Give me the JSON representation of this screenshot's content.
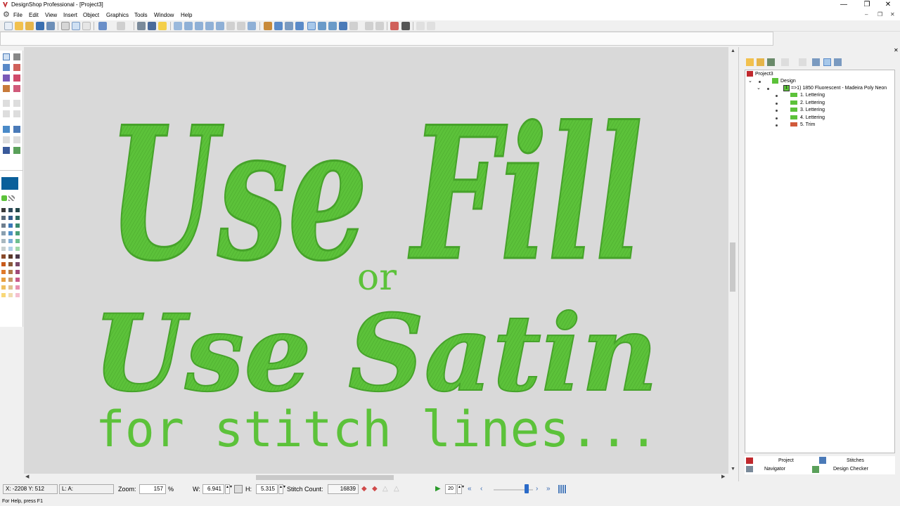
{
  "window": {
    "title": "DesignShop Professional - [Project3]",
    "minimize": "—",
    "restore": "❐",
    "close": "✕"
  },
  "menu": {
    "items": [
      "File",
      "Edit",
      "View",
      "Insert",
      "Object",
      "Graphics",
      "Tools",
      "Window",
      "Help"
    ],
    "mdi_minimize": "–",
    "mdi_restore": "❐",
    "mdi_close": "✕"
  },
  "design": {
    "lines": [
      "Use Fill",
      "or",
      "Use Satin",
      "for stitch lines..."
    ],
    "thread_color": "#5cc23a",
    "canvas_color": "#d9d9d9"
  },
  "docker": {
    "close": "✕",
    "tree": {
      "root": "Project3",
      "design": "Design",
      "color_badge": "1",
      "color_entry": "=>1) 1850 Fluorescent - Madeira Poly Neon",
      "objects": [
        "1. Lettering",
        "2. Lettering",
        "3. Lettering",
        "4. Lettering",
        "5. Trim"
      ]
    },
    "tabs": {
      "project": "Project",
      "stitches": "Stitches",
      "navigator": "Navigator",
      "design_checker": "Design Checker"
    }
  },
  "status": {
    "coords": "X: -2208  Y: 512",
    "layer": "L: A:",
    "zoom_label": "Zoom:",
    "zoom_value": "157",
    "zoom_unit": "%",
    "w_label": "W:",
    "w_value": "6.941",
    "h_label": "H:",
    "h_value": "5.315",
    "stitch_count_label": "Stitch Count:",
    "stitch_count": "16839",
    "step_value": "20",
    "slider_position": 0.88,
    "help": "For Help, press F1"
  },
  "palette_colors": [
    [
      "#3a3a3a",
      "#2e4a5a",
      "#23484a"
    ],
    [
      "#5a6a7a",
      "#345c8c",
      "#2c6a60"
    ],
    [
      "#6e7e8e",
      "#3c78b8",
      "#3a8a70"
    ],
    [
      "#8aa0b0",
      "#4e90c8",
      "#4aa07a"
    ],
    [
      "#a8b8c0",
      "#7eaed8",
      "#6ec090"
    ],
    [
      "#c8d0d0",
      "#b0d0e8",
      "#a0d8a8"
    ],
    [
      "#8a4a2a",
      "#5a3a2a",
      "#4a3a4a"
    ],
    [
      "#c85a1a",
      "#8a5a3a",
      "#7a4a6a"
    ],
    [
      "#e07a2a",
      "#b07a4a",
      "#a04a7a"
    ],
    [
      "#e8a040",
      "#c89a6a",
      "#c85a8a"
    ],
    [
      "#f0c060",
      "#e0c090",
      "#e890b0"
    ],
    [
      "#f8d878",
      "#f0dcb0",
      "#f4c0d0"
    ]
  ]
}
